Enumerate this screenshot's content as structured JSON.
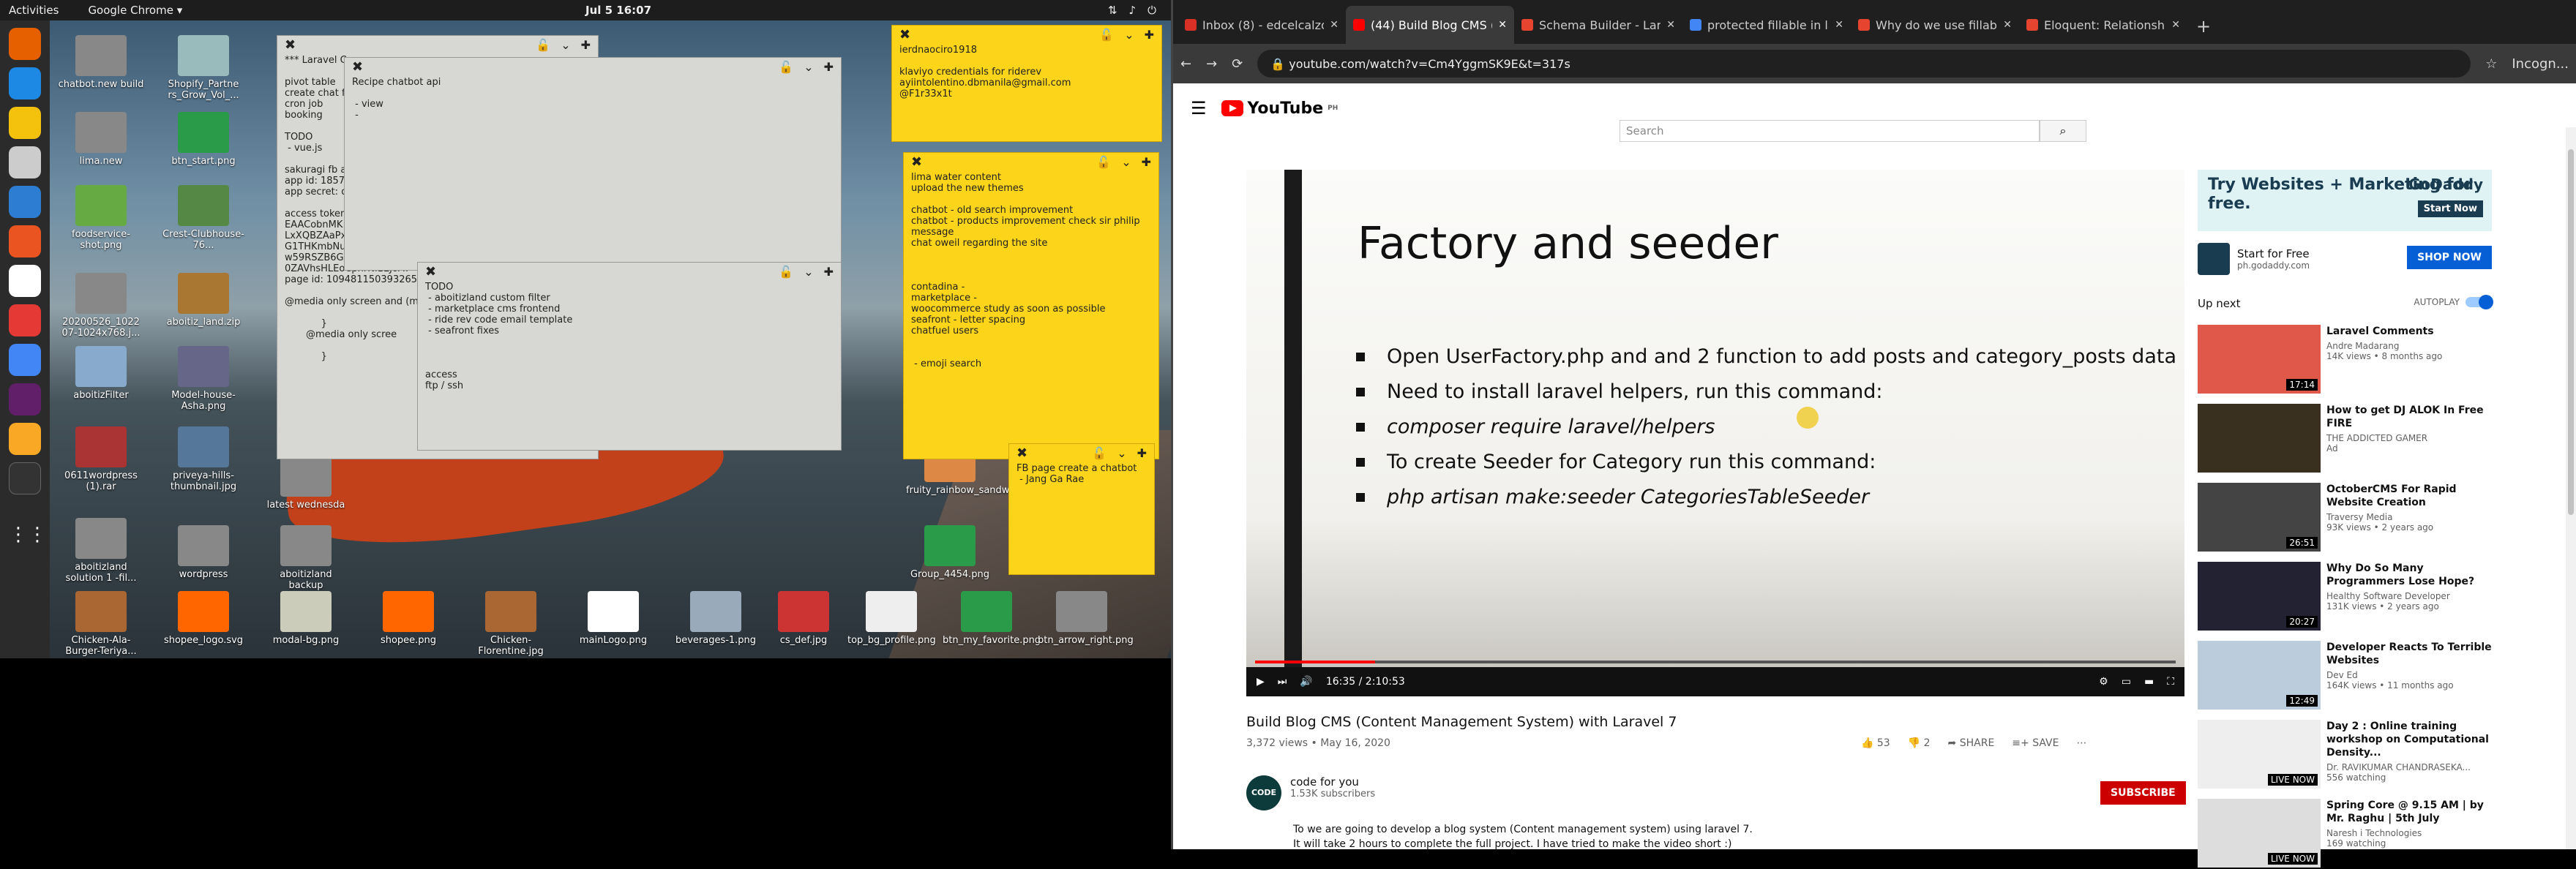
{
  "topbar": {
    "activities": "Activities",
    "app": "Google Chrome ▾",
    "clock": "Jul 5  16:07"
  },
  "desktop": {
    "icons": [
      {
        "label": "chatbot.new build",
        "color": "#888"
      },
      {
        "label": "Shopify_Partne rs_Grow_Vol_...",
        "color": "#9bb"
      },
      {
        "label": "lima.new",
        "color": "#888"
      },
      {
        "label": "btn_start.png",
        "color": "#2a9b48"
      },
      {
        "label": "foodservice-shot.png",
        "color": "#6a4"
      },
      {
        "label": "Crest-Clubhouse-76...",
        "color": "#584"
      },
      {
        "label": "20200526_1022 07-1024x768.j...",
        "color": "#888"
      },
      {
        "label": "aboitiz_land.zip",
        "color": "#a73"
      },
      {
        "label": "aboitizFilter",
        "color": "#8ac"
      },
      {
        "label": "Model-house-Asha.png",
        "color": "#668"
      },
      {
        "label": "0611wordpress (1).rar",
        "color": "#a33"
      },
      {
        "label": "priveya-hills-thumbnail.jpg",
        "color": "#579"
      },
      {
        "label": "latest wednesda",
        "color": "#888"
      },
      {
        "label": "aboitizland solution 1 -fil...",
        "color": "#888"
      },
      {
        "label": "wordpress",
        "color": "#888"
      },
      {
        "label": "aboitizland backup",
        "color": "#888"
      },
      {
        "label": "Chicken-Ala-Burger-Teriya...",
        "color": "#a63"
      },
      {
        "label": "shopee_logo.svg",
        "color": "#f60"
      },
      {
        "label": "modal-bg.png",
        "color": "#ccb"
      },
      {
        "label": "shopee.png",
        "color": "#f60"
      },
      {
        "label": "Chicken-Florentine.jpg",
        "color": "#a63"
      },
      {
        "label": "mainLogo.png",
        "color": "#fff"
      },
      {
        "label": "beverages-1.png",
        "color": "#9ab"
      },
      {
        "label": "cs_def.jpg",
        "color": "#c33"
      },
      {
        "label": "top_bg_profile.png",
        "color": "#eee"
      },
      {
        "label": "btn_my_favorite.png",
        "color": "#2a9b48"
      },
      {
        "label": "btn_arrow_right.png",
        "color": "#888"
      },
      {
        "label": "fruity_rainbow_sandwich.jpg",
        "color": "#d84"
      },
      {
        "label": "Group_4454.png",
        "color": "#2a9b48"
      }
    ],
    "notes": {
      "laravel": "*** Laravel C\n\npivot table\ncreate chat f\ncron job\nbooking\n\nTODO\n - vue.js\n\nsakuragi fb a\napp id: 1857\napp secret: d\n\naccess token\nEAACobnMK\nLxXQBZAaPxnVGQZChVau\nG1THKmbNudEoO6NNiaXQ\nw59RSZB6GAHUmT2NUNif\n0ZAVhsHLEoCphrNl1EJoA7\npage id: 109481150393265\n\n@media only screen and (m\n\n            }\n       @media only scree\n\n            }",
      "recipe": "Recipe chatbot api\n\n - view\n -",
      "todo": "TODO\n - aboitizland custom filter\n - marketplace cms frontend\n - ride rev code email template\n - seafront fixes\n\n\n\naccess\nftp / ssh",
      "credentials": "ierdnaociro1918\n\nklaviyo credentials for riderev\nayiintolentino.dbmanila@gmail.com\n@F1r33x1t",
      "lima": "lima water content\nupload the new themes\n\nchatbot - old search improvement\nchatbot - products improvement check sir philip\nmessage\nchat oweil regarding the site\n\n\n\ncontadina -\nmarketplace -\nwoocommerce study as soon as possible\nseafront - letter spacing\nchatfuel users\n\n\n - emoji search",
      "fb": "FB page create a chatbot\n - Jang Ga Rae"
    }
  },
  "browser": {
    "tabs": [
      {
        "title": "Inbox (8) - edcelcalzoesta",
        "color": "#d93025"
      },
      {
        "title": "(44) Build Blog CMS (Co",
        "color": "#f00"
      },
      {
        "title": "Schema Builder - Laravel",
        "color": "#e74430"
      },
      {
        "title": "protected fillable in lara",
        "color": "#4285f4"
      },
      {
        "title": "Why do we use fillable in",
        "color": "#e74430"
      },
      {
        "title": "Eloquent: Relationships",
        "color": "#e74430"
      }
    ],
    "url": "youtube.com/watch?v=Cm4YggmSK9E&t=317s",
    "profile": "Incogn..."
  },
  "youtube": {
    "logo": "YouTube",
    "region": "PH",
    "search_placeholder": "Search",
    "slide": {
      "title": "Factory and seeder",
      "bullets": [
        "Open UserFactory.php and and 2 function to add posts and category_posts data",
        "Need to install laravel helpers, run this command:",
        "composer require laravel/helpers",
        "To create Seeder for Category run this command:",
        "php artisan make:seeder CategoriesTableSeeder"
      ]
    },
    "time": "16:35 / 2:10:53",
    "progress": 0.13,
    "video_title": "Build Blog CMS (Content Management System) with Laravel 7",
    "views": "3,372 views • May 16, 2020",
    "likes": "53",
    "dislikes": "2",
    "share": "SHARE",
    "save": "SAVE",
    "channel": {
      "name": "code for you",
      "subs": "1.53K subscribers",
      "avatar": "CODE"
    },
    "subscribe": "SUBSCRIBE",
    "description": "To we are going to develop a blog system (Content management system) using laravel 7.\nIt will take 2 hours to complete the full project. I have tried to make the video short :)",
    "ad": {
      "headline": "Try Websites + Marketing for free.",
      "brand": "GoDaddy",
      "cta": "Start Now",
      "name": "Start for Free",
      "url": "ph.godaddy.com",
      "shop": "SHOP NOW"
    },
    "up_next": "Up next",
    "autoplay": "AUTOPLAY",
    "recs": [
      {
        "title": "Laravel Comments",
        "channel": "Andre Madarang",
        "views": "14K views • 8 months ago",
        "duration": "17:14",
        "color": "#e0584a"
      },
      {
        "title": "How to get DJ ALOK In Free FIRE",
        "channel": "THE ADDICTED GAMER",
        "views": "Ad",
        "duration": "",
        "color": "#3a3020"
      },
      {
        "title": "OctoberCMS For Rapid Website Creation",
        "channel": "Traversy Media",
        "views": "93K views • 2 years ago",
        "duration": "26:51",
        "color": "#444"
      },
      {
        "title": "Why Do So Many Programmers Lose Hope?",
        "channel": "Healthy Software Developer",
        "views": "131K views • 2 years ago",
        "duration": "20:27",
        "color": "#223"
      },
      {
        "title": "Developer Reacts To Terrible Websites",
        "channel": "Dev Ed",
        "views": "164K views • 11 months ago",
        "duration": "12:49",
        "color": "#bcd"
      },
      {
        "title": "Day 2 : Online training workshop on Computational Density...",
        "channel": "Dr. RAVIKUMAR CHANDRASEKA...",
        "views": "556 watching",
        "duration": "LIVE NOW",
        "color": "#eee"
      },
      {
        "title": "Spring Core @ 9.15 AM | by Mr. Raghu | 5th July",
        "channel": "Naresh i Technologies",
        "views": "169 watching",
        "duration": "LIVE NOW",
        "color": "#ddd"
      }
    ]
  }
}
